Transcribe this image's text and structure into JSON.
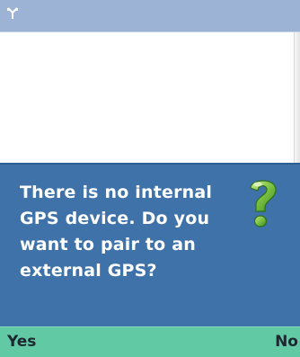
{
  "status_bar": {
    "icon": "signal-antenna-icon"
  },
  "dialog": {
    "message": "There is no internal GPS device. Do you want to pair to an external GPS?",
    "icon": "question-mark-icon"
  },
  "softkeys": {
    "left": "Yes",
    "right": "No"
  },
  "colors": {
    "status_bar": "#9db3d6",
    "dialog_background": "#3f72a8",
    "softkey_bar": "#62c9a5",
    "question_mark": "#7ac043"
  }
}
